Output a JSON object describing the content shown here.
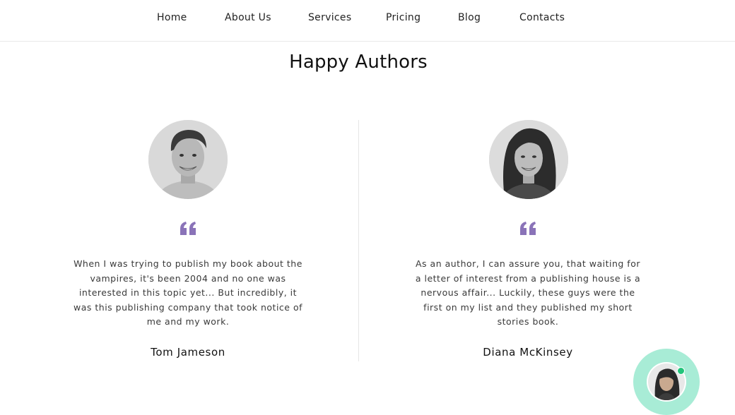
{
  "nav": {
    "items": [
      {
        "label": "Home"
      },
      {
        "label": "About Us"
      },
      {
        "label": "Services"
      },
      {
        "label": "Pricing"
      },
      {
        "label": "Blog"
      },
      {
        "label": "Contacts"
      }
    ]
  },
  "section": {
    "title": "Happy Authors"
  },
  "testimonials": [
    {
      "text": "When I was trying to publish my book about the vampires, it's been 2004 and no one was interested in this topic yet... But incredibly, it was this publishing company that took notice of me and my work.",
      "author": "Tom Jameson",
      "photo_icon": "man-portrait-photo"
    },
    {
      "text": "As an author, I can assure you, that waiting for a letter of interest from a publishing house is a nervous affair... Luckily, these guys were the first on my list and they published my short stories book.",
      "author": "Diana McKinsey",
      "photo_icon": "woman-portrait-photo"
    }
  ],
  "colors": {
    "quote_icon": "#8a73b8",
    "chat_bubble": "#a8ecd6",
    "online_dot": "#21c47a"
  },
  "chat_widget": {
    "icon": "support-agent-avatar",
    "status": "online"
  }
}
